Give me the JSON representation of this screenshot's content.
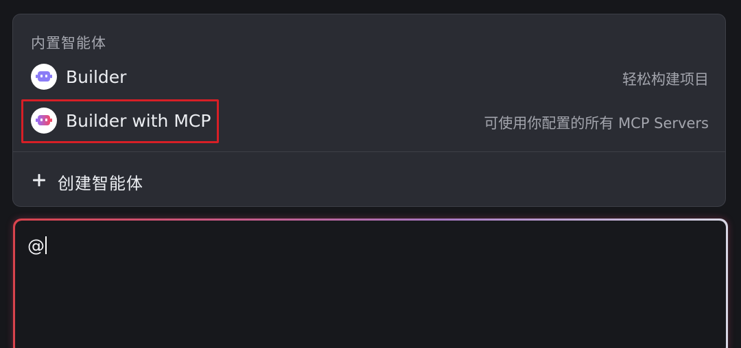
{
  "menu": {
    "section_title": "内置智能体",
    "agents": [
      {
        "name": "Builder",
        "description": "轻松构建项目",
        "icon": "robot-icon"
      },
      {
        "name": "Builder with MCP",
        "description": "可使用你配置的所有 MCP Servers",
        "icon": "robot-mcp-icon"
      }
    ],
    "create_label": "创建智能体",
    "create_icon": "plus-icon"
  },
  "input": {
    "value": "@"
  },
  "colors": {
    "highlight": "#d81f26",
    "panel_bg": "#2a2c33",
    "page_bg": "#16171b"
  }
}
